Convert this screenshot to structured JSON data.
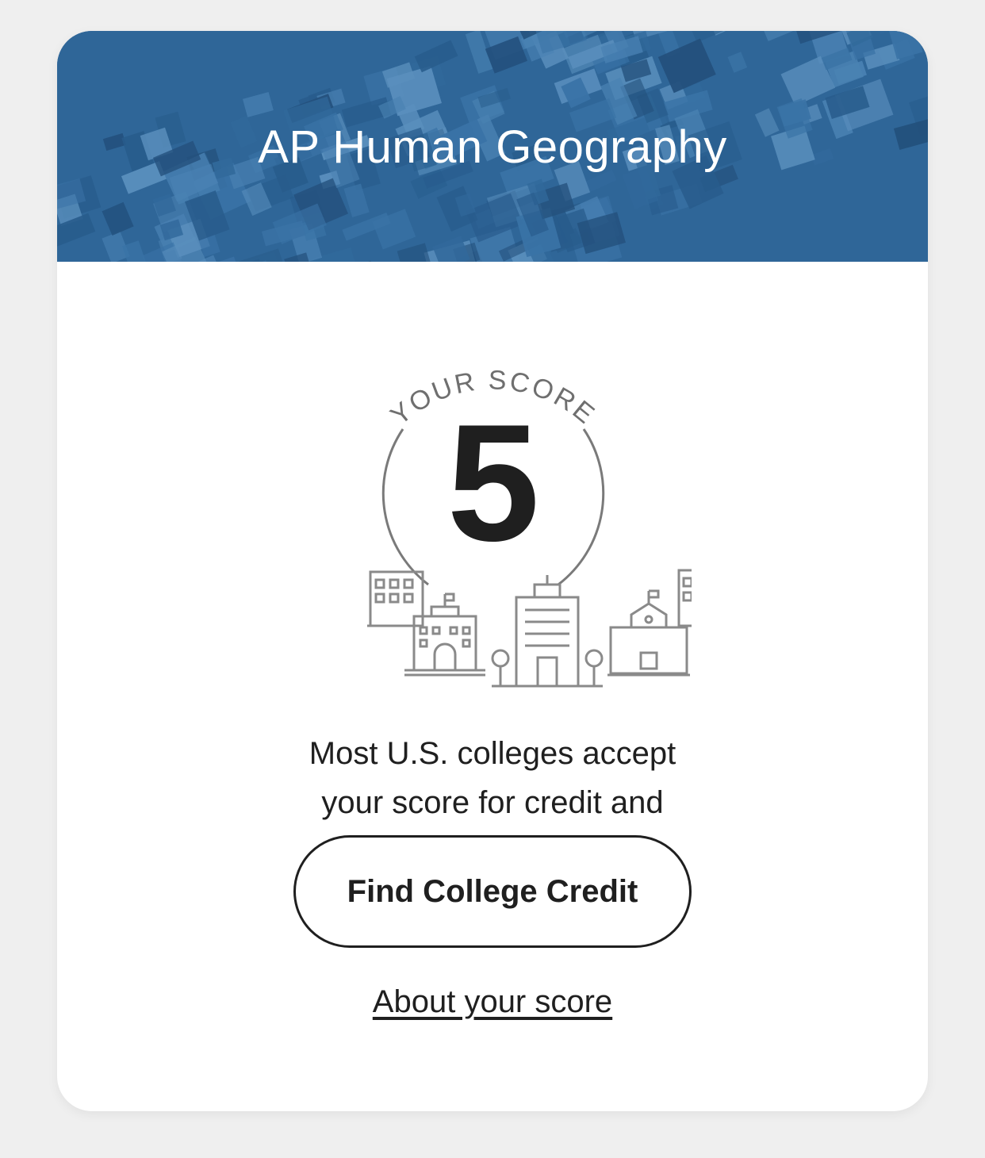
{
  "card": {
    "title": "AP Human Geography",
    "banner_image": "aerial-city-photo-blue-tint",
    "banner_color": "#2f6698"
  },
  "score": {
    "arc_label": "YOUR SCORE",
    "value": "5",
    "illustration": "college-buildings-icon"
  },
  "message": "Most U.S. colleges accept your score for credit and placement.",
  "actions": {
    "find_credit_label": "Find College Credit",
    "about_label": "About your score"
  }
}
